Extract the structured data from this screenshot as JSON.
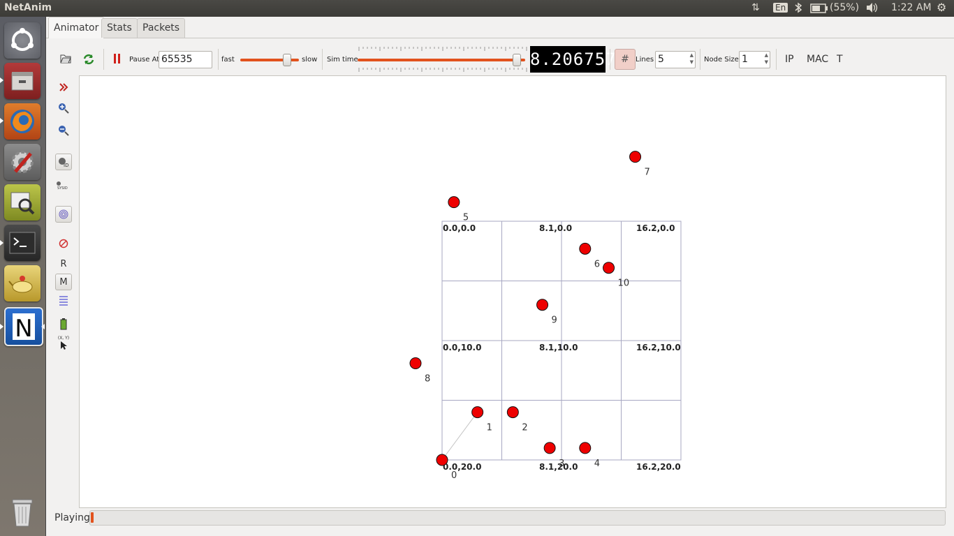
{
  "topbar": {
    "app_title": "NetAnim",
    "lang": "En",
    "battery": "(55%)",
    "clock": "1:22 AM"
  },
  "launcher": {
    "items": [
      "ubuntu-dash",
      "files",
      "firefox",
      "system-settings",
      "image-viewer",
      "terminal",
      "genie",
      "netanim"
    ]
  },
  "tabs": [
    {
      "label": "Animator",
      "active": true
    },
    {
      "label": "Stats",
      "active": false
    },
    {
      "label": "Packets",
      "active": false
    }
  ],
  "toolbar": {
    "pause_at_label": "Pause At",
    "pause_at_value": "65535",
    "fast_label": "fast",
    "slow_label": "slow",
    "speed_level": 0.8,
    "sim_time_label": "Sim time",
    "sim_time_level": 0.95,
    "sim_time_value": "8.2067578",
    "lines_label": "Lines",
    "lines_value": "5",
    "node_size_label": "Node Size",
    "node_size_value": "1",
    "ip_label": "IP",
    "mac_label": "MAC",
    "t_label": "T"
  },
  "left_tools": {
    "r_label": "R",
    "m_label": "M",
    "sysid_label": "SYSID",
    "id_label": "ID",
    "xy_label": "(X, Y)"
  },
  "grid": {
    "x_min": 0.0,
    "x_max": 16.2,
    "y_min": 0.0,
    "y_max": 20.0,
    "labels": [
      "0.0,0.0",
      "8.1,0.0",
      "16.2,0.0",
      "0.0,10.0",
      "8.1,10.0",
      "16.2,10.0",
      "0.0,20.0",
      "8.1,20.0",
      "16.2,20.0"
    ]
  },
  "nodes": [
    {
      "id": "0",
      "x": 0.0,
      "y": 20.0
    },
    {
      "id": "1",
      "x": 2.4,
      "y": 16.0
    },
    {
      "id": "2",
      "x": 4.8,
      "y": 16.0
    },
    {
      "id": "3",
      "x": 7.3,
      "y": 19.0
    },
    {
      "id": "4",
      "x": 9.7,
      "y": 19.0
    },
    {
      "id": "5",
      "x": 0.8,
      "y": -1.6
    },
    {
      "id": "6",
      "x": 9.7,
      "y": 2.3
    },
    {
      "id": "7",
      "x": 13.1,
      "y": -5.4
    },
    {
      "id": "8",
      "x": -1.8,
      "y": 11.9
    },
    {
      "id": "9",
      "x": 6.8,
      "y": 7.0
    },
    {
      "id": "10",
      "x": 11.3,
      "y": 3.9
    }
  ],
  "links": [
    [
      "0",
      "1"
    ]
  ],
  "status": {
    "label": "Playing",
    "progress": 0.003
  },
  "colors": {
    "node_fill": "#ee0000",
    "accent": "#e2521d",
    "grid_line": "#a7a7c2"
  }
}
